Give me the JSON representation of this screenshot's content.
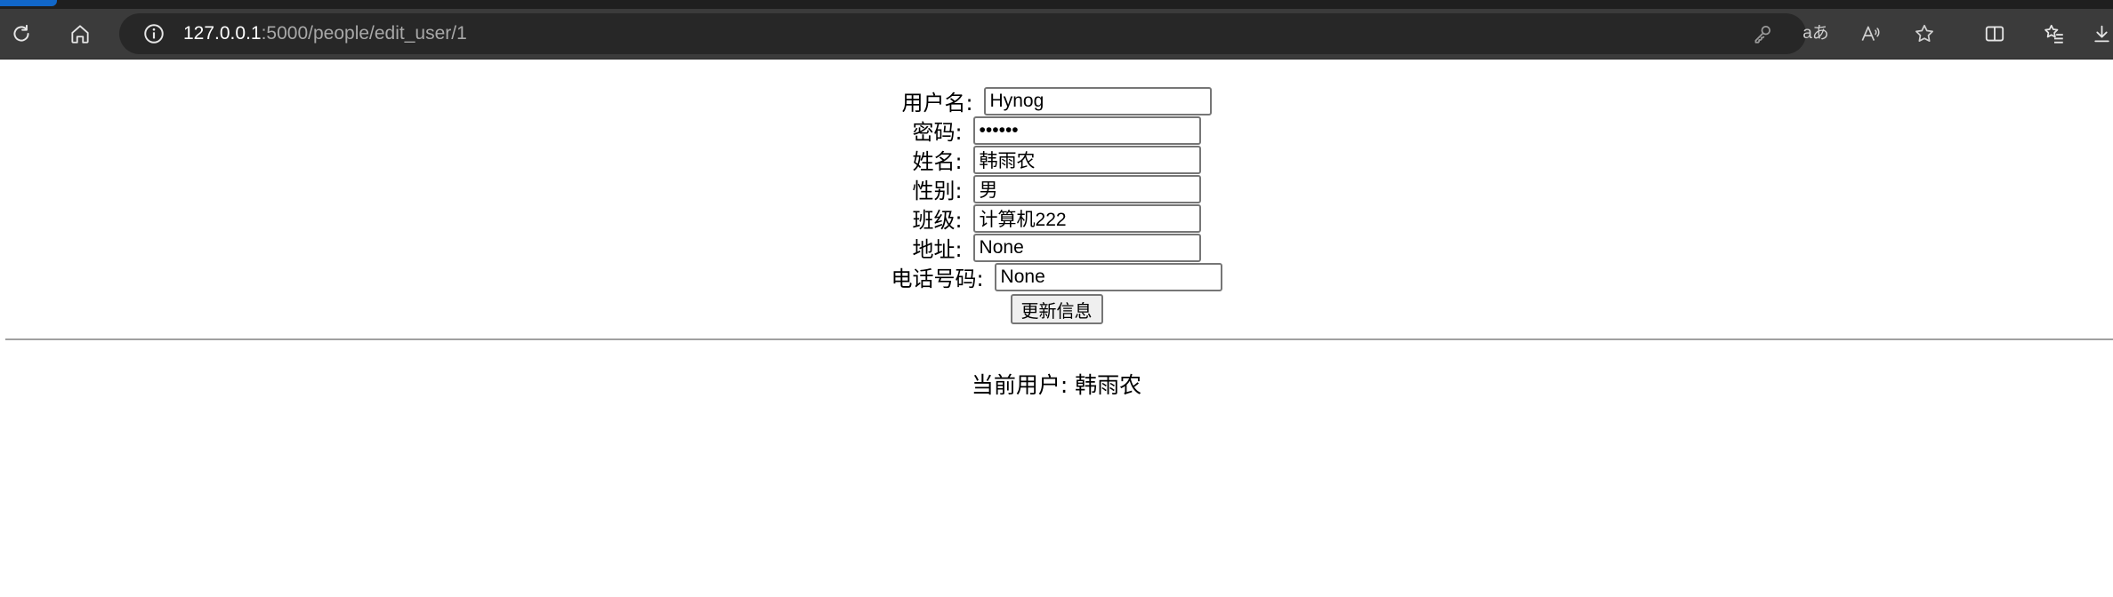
{
  "browser": {
    "url_host": "127.0.0.1",
    "url_path": ":5000/people/edit_user/1",
    "read_aloud_label": "aあ"
  },
  "form": {
    "username_label": "用户名:",
    "username_value": "Hynog",
    "password_label": "密码:",
    "password_value": "••••••",
    "name_label": "姓名:",
    "name_value": "韩雨农",
    "gender_label": "性别:",
    "gender_value": "男",
    "class_label": "班级:",
    "class_value": "计算机222",
    "address_label": "地址:",
    "address_value": "None",
    "phone_label": "电话号码:",
    "phone_value": "None",
    "submit_label": "更新信息"
  },
  "current_user": {
    "text": "当前用户: 韩雨农"
  },
  "colors": {
    "tab_accent": "#1167c9",
    "toolbar_bg": "#3b3b3b",
    "address_bg": "#272727"
  }
}
